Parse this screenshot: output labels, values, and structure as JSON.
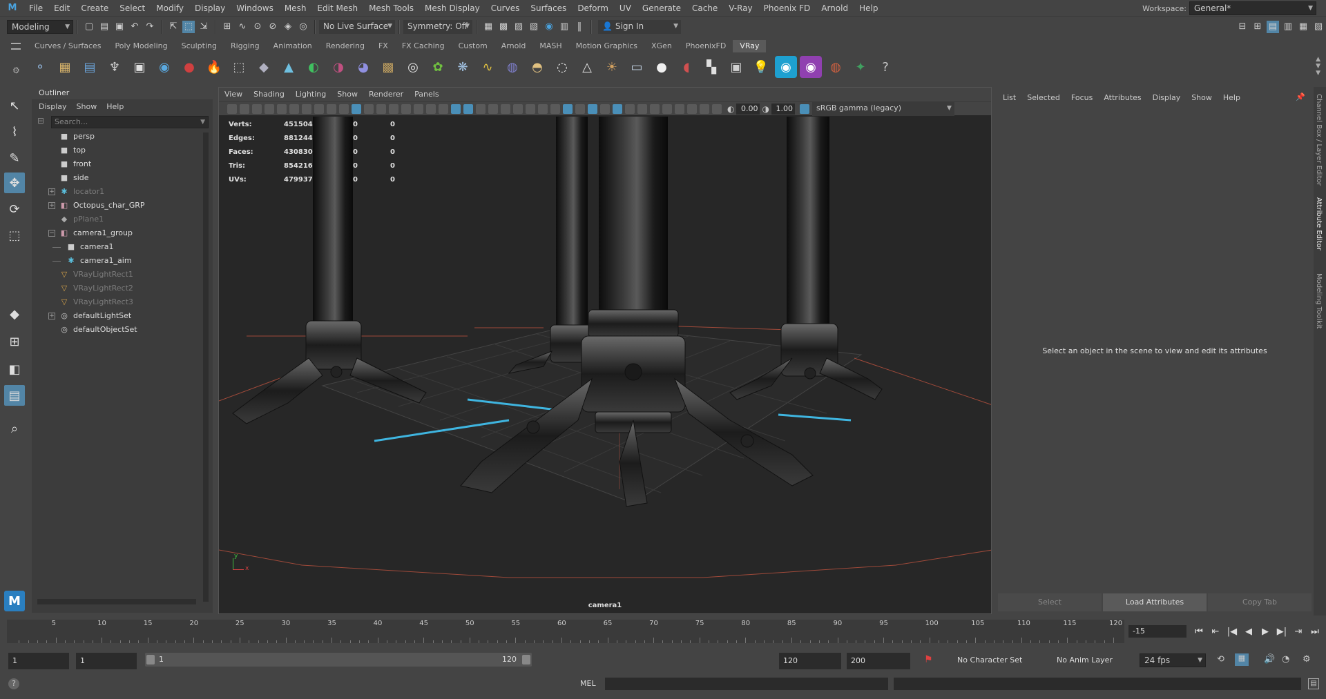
{
  "menubar": {
    "items": [
      "File",
      "Edit",
      "Create",
      "Select",
      "Modify",
      "Display",
      "Windows",
      "Mesh",
      "Edit Mesh",
      "Mesh Tools",
      "Mesh Display",
      "Curves",
      "Surfaces",
      "Deform",
      "UV",
      "Generate",
      "Cache",
      "V-Ray",
      "Phoenix FD",
      "Arnold",
      "Help"
    ],
    "workspace_label": "Workspace:",
    "workspace_value": "General*"
  },
  "statusline": {
    "mode": "Modeling",
    "live_surface": "No Live Surface",
    "symmetry": "Symmetry: Off",
    "sign_in": "Sign In"
  },
  "shelf": {
    "tabs": [
      "Curves / Surfaces",
      "Poly Modeling",
      "Sculpting",
      "Rigging",
      "Animation",
      "Rendering",
      "FX",
      "FX Caching",
      "Custom",
      "Arnold",
      "MASH",
      "Motion Graphics",
      "XGen",
      "PhoenixFD",
      "VRay"
    ],
    "active_tab": "VRay",
    "icon_colors": [
      "#8fb3d9",
      "#d9b56b",
      "#6ba3d9",
      "#cfcfcf",
      "#e0e0e0",
      "#5aa9e0",
      "#d04040",
      "#f09020",
      "#c0c0c0",
      "#b0b0c0",
      "#6fc0e0",
      "#40c060",
      "#c05080",
      "#9090e0",
      "#c0a060",
      "#e0e0e0",
      "#70c040",
      "#a0c0e0",
      "#e0c040",
      "#8080d0",
      "#e0c080",
      "#e8e8e8",
      "#e0e0e0",
      "#d0a060",
      "#c0d0e0",
      "#f0f0f0",
      "#d05050",
      "#e0e0e0",
      "#d0d0d0",
      "#f0d040",
      "#1ea0d0",
      "#9040b0",
      "#d06040",
      "#40a060",
      "#c8c8c8"
    ]
  },
  "outliner": {
    "title": "Outliner",
    "menu": [
      "Display",
      "Show",
      "Help"
    ],
    "search_placeholder": "Search...",
    "items": [
      {
        "label": "persp",
        "icon": "camera-icon",
        "dim": false,
        "expander": "",
        "indent": 0
      },
      {
        "label": "top",
        "icon": "camera-icon",
        "dim": false,
        "expander": "",
        "indent": 0
      },
      {
        "label": "front",
        "icon": "camera-icon",
        "dim": false,
        "expander": "",
        "indent": 0
      },
      {
        "label": "side",
        "icon": "camera-icon",
        "dim": false,
        "expander": "",
        "indent": 0
      },
      {
        "label": "locator1",
        "icon": "locator-icon",
        "dim": true,
        "expander": "+",
        "indent": 0
      },
      {
        "label": "Octopus_char_GRP",
        "icon": "group-icon",
        "dim": false,
        "expander": "+",
        "indent": 0
      },
      {
        "label": "pPlane1",
        "icon": "mesh-icon",
        "dim": true,
        "expander": "",
        "indent": 0
      },
      {
        "label": "camera1_group",
        "icon": "group-icon",
        "dim": false,
        "expander": "−",
        "indent": 0
      },
      {
        "label": "camera1",
        "icon": "camera-icon",
        "dim": false,
        "expander": "",
        "indent": 1
      },
      {
        "label": "camera1_aim",
        "icon": "locator-icon",
        "dim": false,
        "expander": "",
        "indent": 1
      },
      {
        "label": "VRayLightRect1",
        "icon": "light-icon",
        "dim": true,
        "expander": "",
        "indent": 0
      },
      {
        "label": "VRayLightRect2",
        "icon": "light-icon",
        "dim": true,
        "expander": "",
        "indent": 0
      },
      {
        "label": "VRayLightRect3",
        "icon": "light-icon",
        "dim": true,
        "expander": "",
        "indent": 0
      },
      {
        "label": "defaultLightSet",
        "icon": "set-icon",
        "dim": false,
        "expander": "+",
        "indent": 0
      },
      {
        "label": "defaultObjectSet",
        "icon": "set-icon",
        "dim": false,
        "expander": "",
        "indent": 0
      }
    ]
  },
  "viewport": {
    "menu": [
      "View",
      "Shading",
      "Lighting",
      "Show",
      "Renderer",
      "Panels"
    ],
    "exposure": "0.00",
    "gamma": "1.00",
    "color_space": "sRGB gamma (legacy)",
    "hud": [
      {
        "label": "Verts:",
        "value": "451504",
        "c2": "0",
        "c3": "0"
      },
      {
        "label": "Edges:",
        "value": "881244",
        "c2": "0",
        "c3": "0"
      },
      {
        "label": "Faces:",
        "value": "430830",
        "c2": "0",
        "c3": "0"
      },
      {
        "label": "Tris:",
        "value": "854216",
        "c2": "0",
        "c3": "0"
      },
      {
        "label": "UVs:",
        "value": "479937",
        "c2": "0",
        "c3": "0"
      }
    ],
    "camera_label": "camera1",
    "axis_x": "x",
    "axis_y": "y"
  },
  "attribute_editor": {
    "menu": [
      "List",
      "Selected",
      "Focus",
      "Attributes",
      "Display",
      "Show",
      "Help"
    ],
    "message": "Select an object in the scene to view and edit its attributes",
    "buttons": [
      "Select",
      "Load Attributes",
      "Copy Tab"
    ],
    "side_tabs": [
      "Channel Box / Layer Editor",
      "Attribute Editor",
      "Modeling Toolkit"
    ]
  },
  "timeline": {
    "ticks": [
      "5",
      "10",
      "15",
      "20",
      "25",
      "30",
      "35",
      "40",
      "45",
      "50",
      "55",
      "60",
      "65",
      "70",
      "75",
      "80",
      "85",
      "90",
      "95",
      "100",
      "105",
      "110",
      "115",
      "120"
    ],
    "current_frame": "-15"
  },
  "range": {
    "start": "1",
    "anim_start": "1",
    "range_start": "1",
    "range_end": "120",
    "end": "120",
    "anim_end": "200",
    "character_set": "No Character Set",
    "anim_layer": "No Anim Layer",
    "fps": "24 fps"
  },
  "cmdline": {
    "label": "MEL"
  }
}
